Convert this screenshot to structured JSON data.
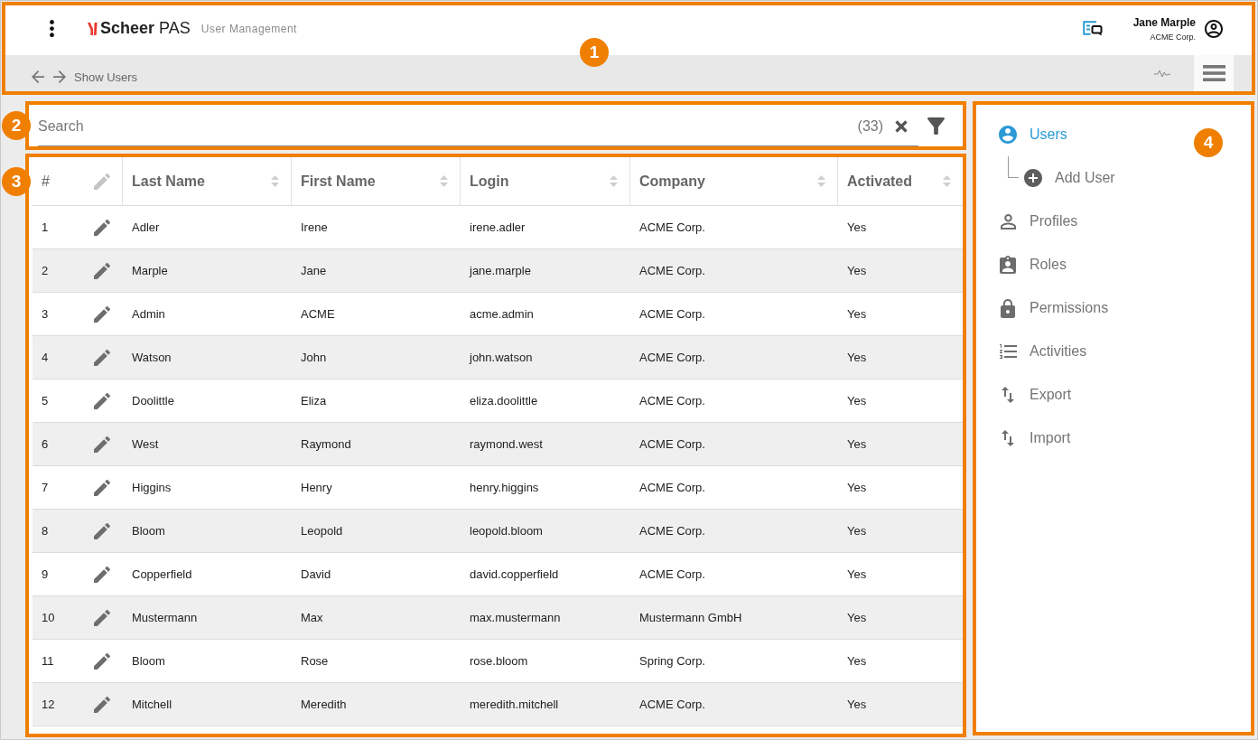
{
  "header": {
    "callout": "1",
    "logo_text": "**Scheer** PAS",
    "app_name": "User Management",
    "user": {
      "name": "Jane Marple",
      "company": "ACME Corp."
    }
  },
  "toolbar": {
    "breadcrumb": "Show Users"
  },
  "search": {
    "callout": "2",
    "placeholder": "Search",
    "count": "(33)"
  },
  "table": {
    "callout": "3",
    "edit_column": true,
    "columns": [
      {
        "kind": "index",
        "label": "#"
      },
      {
        "kind": "sortable",
        "label": "Last Name"
      },
      {
        "kind": "sortable",
        "label": "First Name"
      },
      {
        "kind": "sortable",
        "label": "Login"
      },
      {
        "kind": "sortable",
        "label": "Company"
      },
      {
        "kind": "sortable",
        "label": "Activated"
      }
    ],
    "rows": [
      {
        "cells": [
          "1",
          "Adler",
          "Irene",
          "irene.adler",
          "ACME Corp.",
          "Yes"
        ]
      },
      {
        "cells": [
          "2",
          "Marple",
          "Jane",
          "jane.marple",
          "ACME Corp.",
          "Yes"
        ]
      },
      {
        "cells": [
          "3",
          "Admin",
          "ACME",
          "acme.admin",
          "ACME Corp.",
          "Yes"
        ]
      },
      {
        "cells": [
          "4",
          "Watson",
          "John",
          "john.watson",
          "ACME Corp.",
          "Yes"
        ]
      },
      {
        "cells": [
          "5",
          "Doolittle",
          "Eliza",
          "eliza.doolittle",
          "ACME Corp.",
          "Yes"
        ]
      },
      {
        "cells": [
          "6",
          "West",
          "Raymond",
          "raymond.west",
          "ACME Corp.",
          "Yes"
        ]
      },
      {
        "cells": [
          "7",
          "Higgins",
          "Henry",
          "henry.higgins",
          "ACME Corp.",
          "Yes"
        ]
      },
      {
        "cells": [
          "8",
          "Bloom",
          "Leopold",
          "leopold.bloom",
          "ACME Corp.",
          "Yes"
        ]
      },
      {
        "cells": [
          "9",
          "Copperfield",
          "David",
          "david.copperfield",
          "ACME Corp.",
          "Yes"
        ]
      },
      {
        "cells": [
          "10",
          "Mustermann",
          "Max",
          "max.mustermann",
          "Mustermann GmbH",
          "Yes"
        ]
      },
      {
        "cells": [
          "11",
          "Bloom",
          "Rose",
          "rose.bloom",
          "Spring Corp.",
          "Yes"
        ]
      },
      {
        "cells": [
          "12",
          "Mitchell",
          "Meredith",
          "meredith.mitchell",
          "ACME Corp.",
          "Yes"
        ]
      }
    ]
  },
  "sidebar": {
    "callout": "4",
    "items": [
      {
        "label": "Users",
        "selected": true,
        "children": [
          {
            "label": "Add User",
            "selected": false
          }
        ]
      },
      {
        "label": "Profiles",
        "selected": false
      },
      {
        "label": "Roles",
        "selected": false
      },
      {
        "label": "Permissions",
        "selected": false
      },
      {
        "label": "Activities",
        "selected": false
      },
      {
        "label": "Export",
        "selected": false
      },
      {
        "label": "Import",
        "selected": false
      }
    ]
  }
}
